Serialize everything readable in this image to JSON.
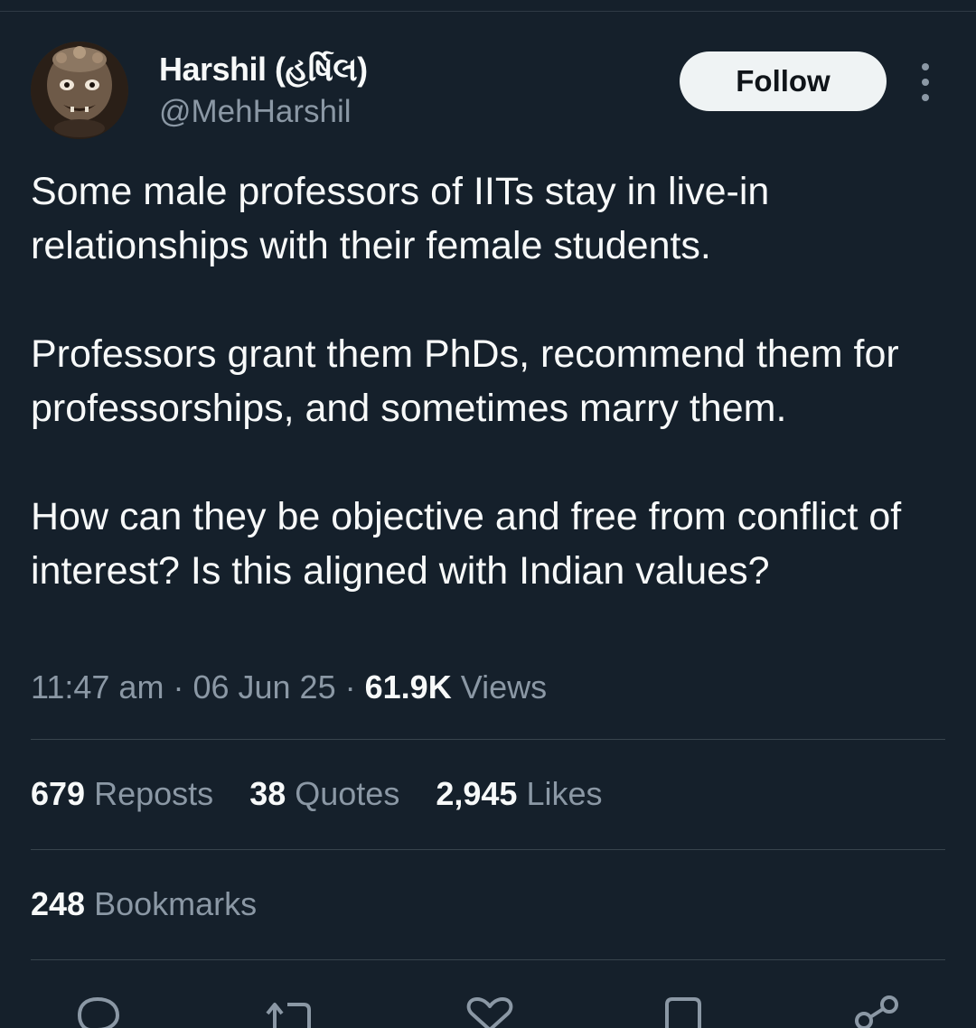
{
  "author": {
    "display_name": "Harshil (હર્ષિલ)",
    "handle": "@MehHarshil",
    "avatar_icon": "carved-mask-avatar"
  },
  "follow_button": {
    "label": "Follow"
  },
  "more_menu": {
    "icon": "more-vertical-icon"
  },
  "tweet": {
    "paragraphs": [
      "Some male professors of IITs stay in live-in relationships with their female students.",
      "Professors grant them PhDs, recommend them for professorships, and sometimes marry them.",
      "How can they be objective and free from conflict of interest? Is this aligned with Indian values?"
    ]
  },
  "meta": {
    "time": "11:47 am",
    "separator": "·",
    "date": "06 Jun 25",
    "views_count": "61.9K",
    "views_label": "Views"
  },
  "stats": {
    "reposts_count": "679",
    "reposts_label": "Reposts",
    "quotes_count": "38",
    "quotes_label": "Quotes",
    "likes_count": "2,945",
    "likes_label": "Likes",
    "bookmarks_count": "248",
    "bookmarks_label": "Bookmarks"
  },
  "actions": [
    "reply-icon",
    "repost-icon",
    "like-icon",
    "bookmark-icon",
    "share-icon"
  ],
  "colors": {
    "background": "#15202b",
    "primary_text": "#f7f9f9",
    "secondary_text": "#8b98a5",
    "divider": "#38444d",
    "follow_bg": "#eff3f4"
  }
}
